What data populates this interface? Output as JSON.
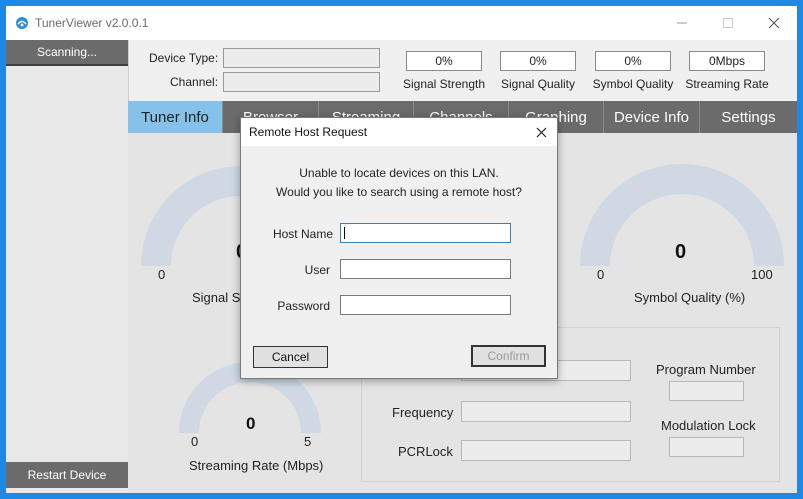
{
  "window": {
    "title": "TunerViewer v2.0.0.1"
  },
  "sidebar": {
    "scan_label": "Scanning...",
    "restart_label": "Restart Device"
  },
  "header": {
    "device_type_label": "Device Type:",
    "channel_label": "Channel:",
    "meters": [
      {
        "value": "0%",
        "label": "Signal Strength"
      },
      {
        "value": "0%",
        "label": "Signal Quality"
      },
      {
        "value": "0%",
        "label": "Symbol Quality"
      },
      {
        "value": "0Mbps",
        "label": "Streaming Rate"
      }
    ]
  },
  "tabs": [
    {
      "label": "Tuner Info",
      "active": true
    },
    {
      "label": "Browser",
      "active": false
    },
    {
      "label": "Streaming",
      "active": false
    },
    {
      "label": "Channels",
      "active": false
    },
    {
      "label": "Graphing",
      "active": false
    },
    {
      "label": "Device Info",
      "active": false
    },
    {
      "label": "Settings",
      "active": false
    }
  ],
  "gauges": {
    "signal_strength": {
      "value": "0",
      "min": "0",
      "caption": "Signal Strength (%)"
    },
    "symbol_quality": {
      "value": "0",
      "min": "0",
      "max": "100",
      "caption": "Symbol Quality (%)"
    },
    "streaming_rate": {
      "value": "0",
      "min": "0",
      "max": "5",
      "caption": "Streaming Rate (Mbps)"
    }
  },
  "details": {
    "frequency_label": "Frequency",
    "pcrlock_label": "PCRLock",
    "program_number_label": "Program Number",
    "modulation_lock_label": "Modulation Lock"
  },
  "dialog": {
    "title": "Remote Host Request",
    "message_line1": "Unable to locate devices on this LAN.",
    "message_line2": "Would you like to search using a remote host?",
    "host_name_label": "Host Name",
    "user_label": "User",
    "password_label": "Password",
    "host_name_value": "",
    "user_value": "",
    "password_value": "",
    "cancel_label": "Cancel",
    "confirm_label": "Confirm"
  },
  "colors": {
    "desktop": "#1e88e5",
    "tab_bar": "#6b6b6b",
    "tab_active": "#86c1ea",
    "gauge_track": "#cfd8e3"
  },
  "icons": {
    "app": "tuner-app-icon",
    "minimize": "minimize-icon",
    "maximize": "maximize-icon",
    "close": "close-icon",
    "dialog_close": "dialog-close-icon"
  }
}
